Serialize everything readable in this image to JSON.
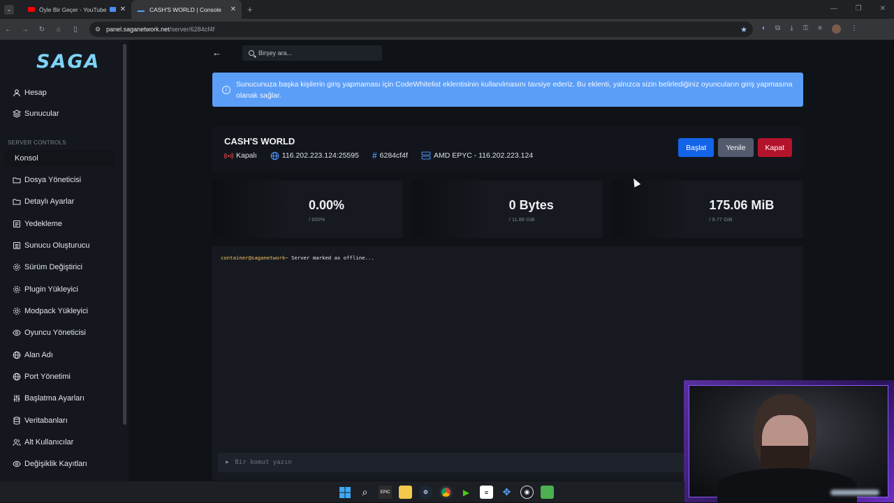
{
  "browser": {
    "tabs": [
      {
        "label": "Öyle Bir Geçer - YouTube"
      },
      {
        "label": "CASH'S WORLD | Console"
      }
    ],
    "url_host": "panel.saganetwork.net",
    "url_path": "/server/6284cf4f"
  },
  "sidebar": {
    "logo": "SAGA",
    "top_items": [
      {
        "label": "Hesap",
        "icon": "user-icon"
      },
      {
        "label": "Sunucular",
        "icon": "layers-icon"
      }
    ],
    "section_label": "SERVER CONTROLS",
    "items": [
      {
        "label": "Konsol"
      },
      {
        "label": "Dosya Yöneticisi"
      },
      {
        "label": "Detaylı Ayarlar"
      },
      {
        "label": "Yedekleme"
      },
      {
        "label": "Sunucu Oluşturucu"
      },
      {
        "label": "Sürüm Değiştirici"
      },
      {
        "label": "Plugin Yükleyici"
      },
      {
        "label": "Modpack Yükleyici"
      },
      {
        "label": "Oyuncu Yöneticisi"
      },
      {
        "label": "Alan Adı"
      },
      {
        "label": "Port Yönetimi"
      },
      {
        "label": "Başlatma Ayarları"
      },
      {
        "label": "Veritabanları"
      },
      {
        "label": "Alt Kullanıcılar"
      },
      {
        "label": "Değişiklik Kayıtları"
      }
    ]
  },
  "search": {
    "placeholder": "Birşey ara..."
  },
  "alert": {
    "text": "Sunucunuza başka kişilerin giriş yapmaması için CodeWhitelist eklentisinin kullanılmasını tavsiye ederiz. Bu eklenti, yalnızca sizin belirlediğiniz oyuncuların giriş yapmasına olanak sağlar."
  },
  "server": {
    "name": "CASH'S WORLD",
    "status": "Kapalı",
    "address": "116.202.223.124:25595",
    "id": "6284cf4f",
    "node": "AMD EPYC - 116.202.223.124",
    "buttons": {
      "start": "Başlat",
      "restart": "Yenile",
      "stop": "Kapat"
    },
    "colors": {
      "start": "#1464ea",
      "restart": "#545b6d",
      "stop": "#b3142b",
      "status": "#e5484d"
    }
  },
  "stats": [
    {
      "value": "0.00%",
      "limit": "/ 600%"
    },
    {
      "value": "0 Bytes",
      "limit": "/ 11.88 GiB"
    },
    {
      "value": "175.06 MiB",
      "limit": "/ 9.77 GiB"
    }
  ],
  "console": {
    "prompt": "container@saganetwork~",
    "message": "Server marked as offline...",
    "input_placeholder": "Bir komut yazın"
  }
}
